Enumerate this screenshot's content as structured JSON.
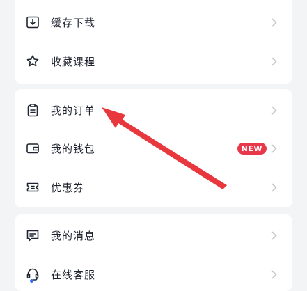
{
  "menu": {
    "group1": [
      {
        "label": "缓存下载",
        "icon": "download-box-icon"
      },
      {
        "label": "收藏课程",
        "icon": "star-icon"
      }
    ],
    "group2": [
      {
        "label": "我的订单",
        "icon": "clipboard-icon"
      },
      {
        "label": "我的钱包",
        "icon": "wallet-icon",
        "badge": "NEW"
      },
      {
        "label": "优惠券",
        "icon": "ticket-icon"
      }
    ],
    "group3": [
      {
        "label": "我的消息",
        "icon": "message-icon"
      },
      {
        "label": "在线客服",
        "icon": "headset-icon"
      }
    ]
  },
  "colors": {
    "background": "#f3f4f6",
    "card": "#ffffff",
    "badge": "#e8384a",
    "annotation_arrow": "#e8383d",
    "chevron": "#c4c6cc"
  }
}
